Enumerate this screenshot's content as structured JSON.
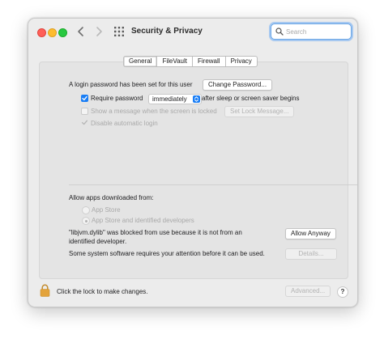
{
  "window": {
    "title": "Security & Privacy",
    "search_placeholder": "Search"
  },
  "tabs": [
    "General",
    "FileVault",
    "Firewall",
    "Privacy"
  ],
  "general": {
    "login_password_text": "A login password has been set for this user",
    "change_password_label": "Change Password...",
    "require_password_label": "Require password",
    "require_password_checked": true,
    "require_password_value": "immediately",
    "after_sleep_text": "after sleep or screen saver begins",
    "show_message_label": "Show a message when the screen is locked",
    "show_message_checked": false,
    "set_lock_message_label": "Set Lock Message...",
    "disable_auto_login_label": "Disable automatic login",
    "disable_auto_login_checked": true
  },
  "downloads": {
    "heading": "Allow apps downloaded from:",
    "option_app_store": "App Store",
    "option_app_store_identified": "App Store and identified developers",
    "selected": "App Store and identified developers",
    "blocked_line1": "\"libjvm.dylib\" was blocked from use because it is not from an",
    "blocked_line2": "identified developer.",
    "allow_anyway_label": "Allow Anyway",
    "system_software_text": "Some system software requires your attention before it can be used.",
    "details_label": "Details..."
  },
  "footer": {
    "lock_text": "Click the lock to make changes.",
    "advanced_label": "Advanced...",
    "help_label": "?"
  },
  "colors": {
    "accent": "#1a7ef5",
    "lock": "#e3a33b"
  }
}
